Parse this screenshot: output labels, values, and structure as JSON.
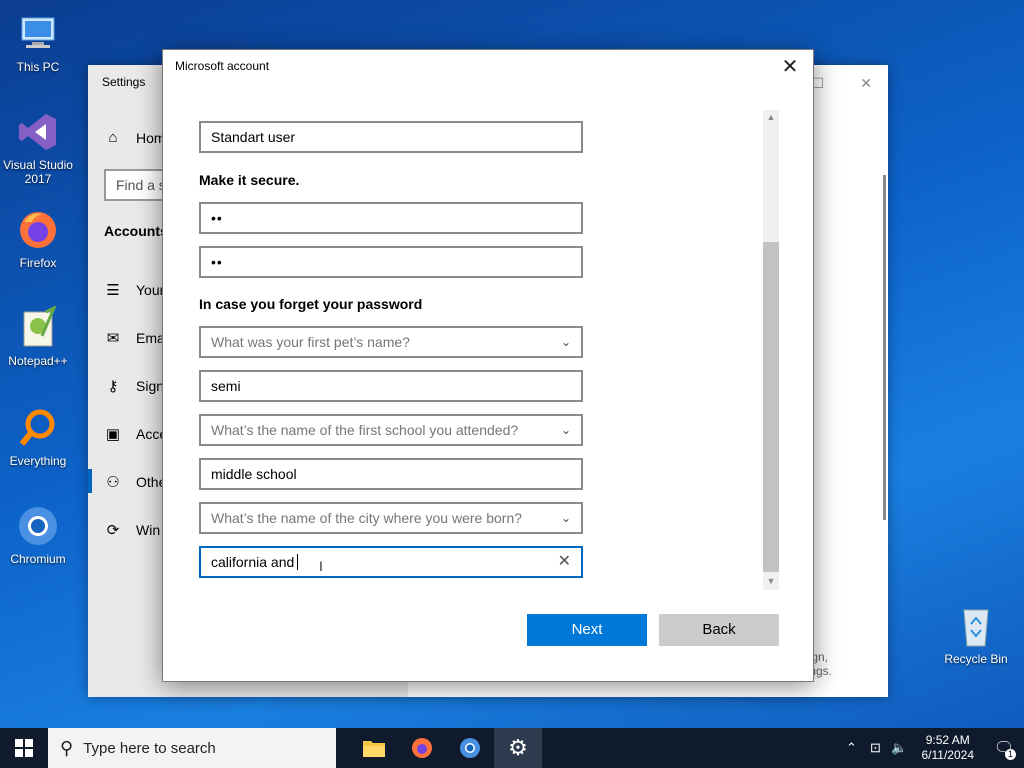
{
  "desktop": {
    "icons": [
      {
        "label": "This PC"
      },
      {
        "label": "Visual Studio 2017"
      },
      {
        "label": "Firefox"
      },
      {
        "label": "Notepad++"
      },
      {
        "label": "Everything"
      },
      {
        "label": "Chromium"
      },
      {
        "label": "Recycle Bin"
      }
    ]
  },
  "settings": {
    "title": "Settings",
    "home": "Hom",
    "search_placeholder": "Find a s",
    "heading": "Accounts",
    "items": [
      "Your",
      "Ema",
      "Sign",
      "Acce",
      "Othe",
      "Win"
    ],
    "footer_line1": "gn,",
    "footer_line2": "ngs."
  },
  "dialog": {
    "title": "Microsoft account",
    "account_type": "Standart user",
    "secure_heading": "Make it secure.",
    "password": "••",
    "password_confirm": "••",
    "forgot_heading": "In case you forget your password",
    "q1": "What was your first pet’s name?",
    "a1": "semi",
    "q2": "What’s the name of the first school you attended?",
    "a2": "middle school",
    "q3": "What’s the name of the city where you were born?",
    "a3": "california and",
    "next_label": "Next",
    "back_label": "Back"
  },
  "taskbar": {
    "search_placeholder": "Type here to search",
    "time": "9:52 AM",
    "date": "6/11/2024",
    "notification_count": "1"
  },
  "colors": {
    "accent": "#0078d7",
    "desktop": "#0d63c9"
  }
}
